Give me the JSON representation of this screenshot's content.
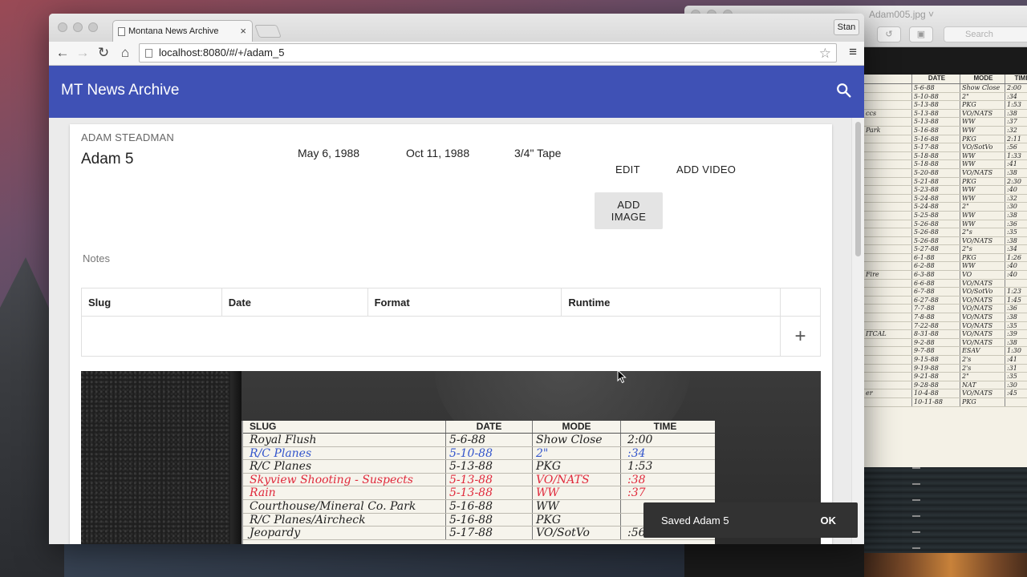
{
  "preview_window": {
    "title": "Adam005.jpg ˅",
    "search_placeholder": "Search",
    "card": {
      "headers": [
        "",
        "DATE",
        "MODE",
        "TIME"
      ],
      "rows": [
        [
          "",
          "5-6-88",
          "Show Close",
          "2:00"
        ],
        [
          "",
          "5-10-88",
          "2\"",
          ":34"
        ],
        [
          "",
          "5-13-88",
          "PKG",
          "1:53"
        ],
        [
          "ccs",
          "5-13-88",
          "VO/NATS",
          ":38"
        ],
        [
          "",
          "5-13-88",
          "WW",
          ":37"
        ],
        [
          "Park",
          "5-16-88",
          "WW",
          ":32"
        ],
        [
          "",
          "5-16-88",
          "PKG",
          "2:11"
        ],
        [
          "",
          "5-17-88",
          "VO/SotVo",
          ":56"
        ],
        [
          "",
          "5-18-88",
          "WW",
          "1:33"
        ],
        [
          "",
          "5-18-88",
          "WW",
          ":41"
        ],
        [
          "",
          "5-20-88",
          "VO/NATS",
          ":38"
        ],
        [
          "",
          "5-21-88",
          "PKG",
          "2:30"
        ],
        [
          "",
          "5-23-88",
          "WW",
          ":40"
        ],
        [
          "",
          "5-24-88",
          "WW",
          ":32"
        ],
        [
          "",
          "5-24-88",
          "2\"",
          ":30"
        ],
        [
          "",
          "5-25-88",
          "WW",
          ":38"
        ],
        [
          "",
          "5-26-88",
          "WW",
          ":36"
        ],
        [
          "",
          "5-26-88",
          "2\"s",
          ":35"
        ],
        [
          "",
          "5-26-88",
          "VO/NATS",
          ":38"
        ],
        [
          "",
          "5-27-88",
          "2\"s",
          ":34"
        ],
        [
          "",
          "6-1-88",
          "PKG",
          "1:26"
        ],
        [
          "",
          "6-2-88",
          "WW",
          ":40"
        ],
        [
          "Fire",
          "6-3-88",
          "VO",
          ":40"
        ],
        [
          "",
          "6-6-88",
          "VO/NATS",
          ""
        ],
        [
          "",
          "6-7-88",
          "VO/SotVo",
          "1:23"
        ],
        [
          "",
          "6-27-88",
          "VO/NATS",
          "1:45"
        ],
        [
          "",
          "7-7-88",
          "VO/NATS",
          ":36"
        ],
        [
          "",
          "7-8-88",
          "VO/NATS",
          ":38"
        ],
        [
          "",
          "7-22-88",
          "VO/NATS",
          ":35"
        ],
        [
          "ITCAL",
          "8-31-88",
          "VO/NATS",
          ":39"
        ],
        [
          "",
          "9-2-88",
          "VO/NATS",
          ":38"
        ],
        [
          "",
          "9-7-88",
          "ESAV",
          "1:30"
        ],
        [
          "",
          "9-15-88",
          "2's",
          ":41"
        ],
        [
          "",
          "9-19-88",
          "2's",
          ":31"
        ],
        [
          "",
          "9-21-88",
          "2\"",
          ":35"
        ],
        [
          "",
          "9-28-88",
          "NAT",
          ":30"
        ],
        [
          "er",
          "10-4-88",
          "VO/NATS",
          ":45"
        ],
        [
          "",
          "10-11-88",
          "PKG",
          ""
        ]
      ]
    }
  },
  "browser": {
    "tab_title": "Montana News Archive",
    "tab_close": "×",
    "user_button": "Stan",
    "url": "localhost:8080/#/+/adam_5",
    "back": "←",
    "forward": "→",
    "reload": "↻",
    "home": "⌂",
    "star": "☆",
    "menu": "≡"
  },
  "app": {
    "title": "MT News Archive",
    "accent_color": "#3f51b5"
  },
  "collection": {
    "owner": "ADAM STEADMAN",
    "name": "Adam 5",
    "start_date": "May 6, 1988",
    "end_date": "Oct 11, 1988",
    "format": "3/4\" Tape",
    "edit_label": "EDIT",
    "add_video_label": "ADD VIDEO",
    "add_image_label": "ADD IMAGE",
    "notes_label": "Notes"
  },
  "episodes_table": {
    "columns": [
      "Slug",
      "Date",
      "Format",
      "Runtime"
    ],
    "add_label": "+"
  },
  "scan": {
    "headers": [
      "SLUG",
      "DATE",
      "MODE",
      "TIME"
    ],
    "rows": [
      {
        "slug": "Royal Flush",
        "date": "5-6-88",
        "mode": "Show Close",
        "time": "2:00",
        "color": "#222222"
      },
      {
        "slug": "R/C Planes",
        "date": "5-10-88",
        "mode": "2\"",
        "time": ":34",
        "color": "#3355cc"
      },
      {
        "slug": "R/C Planes",
        "date": "5-13-88",
        "mode": "PKG",
        "time": "1:53",
        "color": "#222222"
      },
      {
        "slug": "Skyview Shooting - Suspects",
        "date": "5-13-88",
        "mode": "VO/NATS",
        "time": ":38",
        "color": "#e02a3c"
      },
      {
        "slug": "Rain",
        "date": "5-13-88",
        "mode": "WW",
        "time": ":37",
        "color": "#e02a3c"
      },
      {
        "slug": "Courthouse/Mineral Co. Park",
        "date": "5-16-88",
        "mode": "WW",
        "time": "",
        "color": "#222222"
      },
      {
        "slug": "R/C Planes/Aircheck",
        "date": "5-16-88",
        "mode": "PKG",
        "time": "",
        "color": "#222222"
      },
      {
        "slug": "Jeopardy",
        "date": "5-17-88",
        "mode": "VO/SotVo",
        "time": ":56",
        "color": "#222222"
      }
    ]
  },
  "snackbar": {
    "message": "Saved Adam 5",
    "action": "OK"
  }
}
